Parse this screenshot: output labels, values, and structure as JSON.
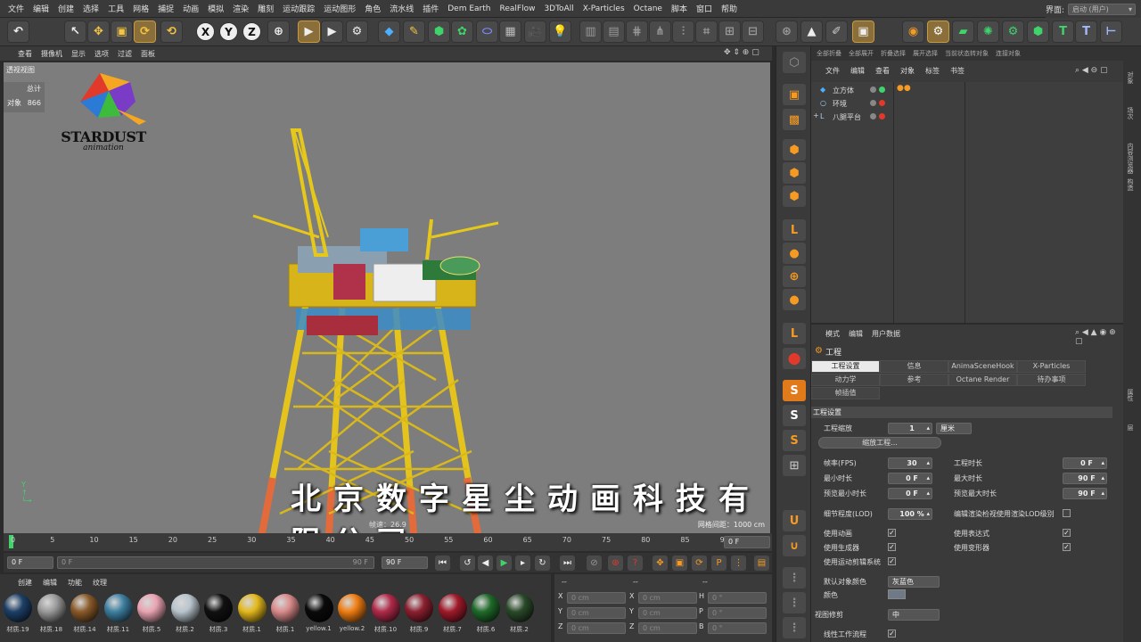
{
  "menubar": [
    "文件",
    "编辑",
    "创建",
    "选择",
    "工具",
    "网格",
    "捕捉",
    "动画",
    "模拟",
    "渲染",
    "雕刻",
    "运动跟踪",
    "运动图形",
    "角色",
    "流水线",
    "插件",
    "Dem Earth",
    "RealFlow",
    "3DToAll",
    "X-Particles",
    "Octane",
    "脚本",
    "窗口",
    "帮助"
  ],
  "layout": {
    "label": "界面:",
    "value": "启动 (用户)"
  },
  "viewport_menu": [
    "查看",
    "摄像机",
    "显示",
    "选项",
    "过滤",
    "面板"
  ],
  "viewport": {
    "label": "透视视图",
    "stats_total": "总计",
    "stats_objects": "对象",
    "stats_count": "866",
    "speed": "帧速：26.9",
    "grid": "网格间距：1000 cm"
  },
  "logo": {
    "text": "STARDUST",
    "sub": "animation"
  },
  "watermark": "北京数字星尘动画科技有限公司",
  "timeline": {
    "ticks": [
      "0",
      "5",
      "10",
      "15",
      "20",
      "25",
      "30",
      "35",
      "40",
      "45",
      "50",
      "55",
      "60",
      "65",
      "70",
      "75",
      "80",
      "85",
      "90"
    ],
    "end_frame": "0 F"
  },
  "playbar": {
    "start": "0 F",
    "range_start": "0 F",
    "range_end": "90 F",
    "end": "90 F"
  },
  "materials": {
    "menu": [
      "创建",
      "编辑",
      "功能",
      "纹理"
    ],
    "items": [
      {
        "name": "材质.19",
        "color": "#1d3f66"
      },
      {
        "name": "材质.18",
        "color": "#9a9a9a"
      },
      {
        "name": "材质.14",
        "color": "#8a5a2a"
      },
      {
        "name": "材质.11",
        "color": "#3d7fa0"
      },
      {
        "name": "材质.5",
        "color": "#e9a3b2"
      },
      {
        "name": "材质.2",
        "color": "#b8c4cc"
      },
      {
        "name": "材质.3",
        "color": "#111111"
      },
      {
        "name": "材质.1",
        "color": "#e3b81c"
      },
      {
        "name": "材质.1",
        "color": "#d98a8a"
      },
      {
        "name": "yellow.1",
        "color": "#0a0a0a"
      },
      {
        "name": "yellow.2",
        "color": "#ef7d12"
      },
      {
        "name": "材质.10",
        "color": "#b02a4a"
      },
      {
        "name": "材质.9",
        "color": "#8c2030"
      },
      {
        "name": "材质.7",
        "color": "#a01a2a"
      },
      {
        "name": "材质.6",
        "color": "#1f6a2a"
      },
      {
        "name": "材质.2",
        "color": "#2a4a2a"
      }
    ]
  },
  "coords": {
    "header": "--",
    "rows": [
      {
        "a": "X",
        "av": "0 cm",
        "b": "X",
        "bv": "0 cm",
        "c": "H",
        "cv": "0 °"
      },
      {
        "a": "Y",
        "av": "0 cm",
        "b": "Y",
        "bv": "0 cm",
        "c": "P",
        "cv": "0 °"
      },
      {
        "a": "Z",
        "av": "0 cm",
        "b": "Z",
        "bv": "0 cm",
        "c": "B",
        "cv": "0 °"
      }
    ]
  },
  "object_manager": {
    "top": [
      "全部折叠",
      "全部展开",
      "折叠选择",
      "展开选择",
      "当前状态转对象",
      "连接对象"
    ],
    "menu": [
      "文件",
      "编辑",
      "查看",
      "对象",
      "标签",
      "书签"
    ],
    "objects": [
      "立方体",
      "环境",
      "八腿平台"
    ]
  },
  "right_strip": [
    "对象",
    "场次",
    "内容浏览器",
    "构造",
    "属性",
    "层"
  ],
  "attributes": {
    "menu": [
      "模式",
      "编辑",
      "用户数据"
    ],
    "title": "工程",
    "tabs": [
      "工程设置",
      "信息",
      "AnimaSceneHook",
      "X-Particles",
      "动力学",
      "参考",
      "Octane Render",
      "待办事项",
      "帧插值"
    ],
    "section": "工程设置",
    "scale_label": "工程缩放",
    "scale_value": "1",
    "scale_unit": "厘米",
    "scale_button": "缩放工程...",
    "fps_label": "帧率(FPS)",
    "fps": "30",
    "length_label": "工程时长",
    "length": "0 F",
    "min_label": "最小时长",
    "min": "0 F",
    "max_label": "最大时长",
    "max": "90 F",
    "pmin_label": "预览最小时长",
    "pmin": "0 F",
    "pmax_label": "预览最大时长",
    "pmax": "90 F",
    "lod_label": "细节程度(LOD)",
    "lod": "100 %",
    "lod_check": "编辑渲染检视使用渲染LOD级别",
    "anim_label": "使用动画",
    "expr_label": "使用表达式",
    "gen_label": "使用生成器",
    "deform_label": "使用变形器",
    "motion_label": "使用运动剪辑系统",
    "color_label": "默认对象颜色",
    "color_value": "灰蓝色",
    "color2_label": "颜色",
    "view_label": "视图修剪",
    "view_value": "中",
    "linear_label": "线性工作流程"
  }
}
